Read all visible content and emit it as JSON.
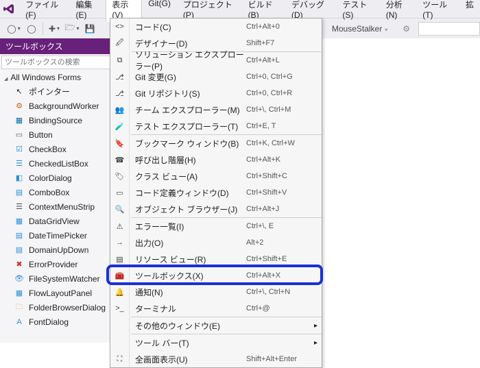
{
  "menubar": {
    "items": [
      "ファイル(F)",
      "編集(E)",
      "表示(V)",
      "Git(G)",
      "プロジェクト(P)",
      "ビルド(B)",
      "デバッグ(D)",
      "テスト(S)",
      "分析(N)",
      "ツール(T)",
      "拡"
    ]
  },
  "toolbar": {
    "mouseStalker": "MouseStalker"
  },
  "toolbox": {
    "title": "ツールボックス",
    "searchPlaceholder": "ツールボックスの検索",
    "group": "All Windows Forms",
    "items": [
      {
        "name": "pointer",
        "label": "ポインター",
        "icon": "↖"
      },
      {
        "name": "backgroundworker",
        "label": "BackgroundWorker",
        "icon": "⚙",
        "c": "#c06010"
      },
      {
        "name": "bindingsource",
        "label": "BindingSource",
        "icon": "▦",
        "c": "#0b6fa4"
      },
      {
        "name": "button",
        "label": "Button",
        "icon": "▭",
        "c": "#555"
      },
      {
        "name": "checkbox",
        "label": "CheckBox",
        "icon": "☑",
        "c": "#2b90d9"
      },
      {
        "name": "checkedlistbox",
        "label": "CheckedListBox",
        "icon": "☰",
        "c": "#2b90d9"
      },
      {
        "name": "colordialog",
        "label": "ColorDialog",
        "icon": "◧",
        "c": "#2b90d9"
      },
      {
        "name": "combobox",
        "label": "ComboBox",
        "icon": "▤",
        "c": "#2b90d9"
      },
      {
        "name": "contextmenustrip",
        "label": "ContextMenuStrip",
        "icon": "☰",
        "c": "#555"
      },
      {
        "name": "datagridview",
        "label": "DataGridView",
        "icon": "▦",
        "c": "#2b90d9"
      },
      {
        "name": "datetimepicker",
        "label": "DateTimePicker",
        "icon": "▤",
        "c": "#2b90d9"
      },
      {
        "name": "domainupdown",
        "label": "DomainUpDown",
        "icon": "▤",
        "c": "#2b90d9"
      },
      {
        "name": "errorprovider",
        "label": "ErrorProvider",
        "icon": "✖",
        "c": "#cc3030"
      },
      {
        "name": "filesystemwatcher",
        "label": "FileSystemWatcher",
        "icon": "👁",
        "c": "#2b90d9"
      },
      {
        "name": "flowlayoutpanel",
        "label": "FlowLayoutPanel",
        "icon": "▦",
        "c": "#2b90d9"
      },
      {
        "name": "folderbrowserdialog",
        "label": "FolderBrowserDialog",
        "icon": "🗀",
        "c": "#d9a441"
      },
      {
        "name": "fontdialog",
        "label": "FontDialog",
        "icon": "A",
        "c": "#2b90d9"
      }
    ]
  },
  "dropdown": {
    "groups": [
      [
        {
          "icon": "<>",
          "label": "コード(C)",
          "shortcut": "Ctrl+Alt+0"
        },
        {
          "icon": "🖉",
          "label": "デザイナー(D)",
          "shortcut": "Shift+F7"
        }
      ],
      [
        {
          "icon": "⧉",
          "label": "ソリューション エクスプローラー(P)",
          "shortcut": "Ctrl+Alt+L"
        },
        {
          "icon": "⎇",
          "label": "Git 変更(G)",
          "shortcut": "Ctrl+0, Ctrl+G"
        },
        {
          "icon": "⎇",
          "label": "Git リポジトリ(S)",
          "shortcut": "Ctrl+0, Ctrl+R"
        },
        {
          "icon": "👥",
          "label": "チーム エクスプローラー(M)",
          "shortcut": "Ctrl+\\, Ctrl+M"
        },
        {
          "icon": "🧪",
          "label": "テスト エクスプローラー(T)",
          "shortcut": "Ctrl+E, T"
        }
      ],
      [
        {
          "icon": "🔖",
          "label": "ブックマーク ウィンドウ(B)",
          "shortcut": "Ctrl+K, Ctrl+W"
        },
        {
          "icon": "☎",
          "label": "呼び出し階層(H)",
          "shortcut": "Ctrl+Alt+K"
        },
        {
          "icon": "🏷",
          "label": "クラス ビュー(A)",
          "shortcut": "Ctrl+Shift+C"
        },
        {
          "icon": "▭",
          "label": "コード定義ウィンドウ(D)",
          "shortcut": "Ctrl+Shift+V"
        },
        {
          "icon": "🔍",
          "label": "オブジェクト ブラウザー(J)",
          "shortcut": "Ctrl+Alt+J"
        }
      ],
      [
        {
          "icon": "⚠",
          "label": "エラー一覧(I)",
          "shortcut": "Ctrl+\\, E"
        },
        {
          "icon": "→",
          "label": "出力(O)",
          "shortcut": "Alt+2"
        },
        {
          "icon": "▤",
          "label": "リソース ビュー(R)",
          "shortcut": "Ctrl+Shift+E"
        },
        {
          "icon": "🧰",
          "label": "ツールボックス(X)",
          "shortcut": "Ctrl+Alt+X",
          "highlight": true
        },
        {
          "icon": "🔔",
          "label": "通知(N)",
          "shortcut": "Ctrl+\\, Ctrl+N"
        },
        {
          "icon": ">_",
          "label": "ターミナル",
          "shortcut": "Ctrl+@"
        }
      ],
      [
        {
          "icon": "",
          "label": "その他のウィンドウ(E)",
          "shortcut": "",
          "sub": true
        }
      ],
      [
        {
          "icon": "",
          "label": "ツール バー(T)",
          "shortcut": "",
          "sub": true
        },
        {
          "icon": "⛶",
          "label": "全画面表示(U)",
          "shortcut": "Shift+Alt+Enter"
        }
      ]
    ]
  }
}
